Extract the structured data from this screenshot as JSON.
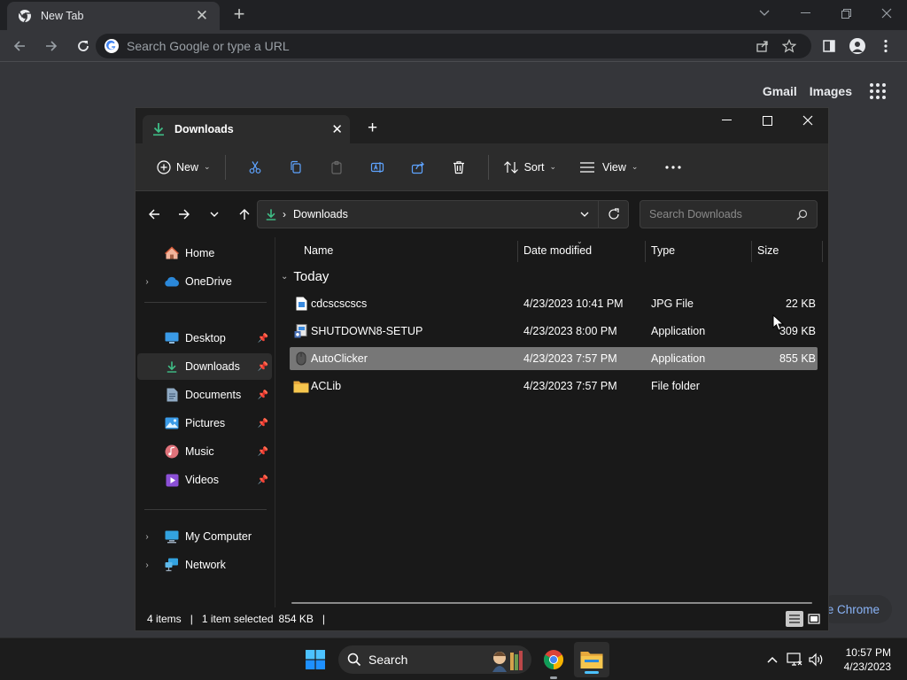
{
  "browser": {
    "tab_title": "New Tab",
    "omnibox_placeholder": "Search Google or type a URL",
    "ntp_links": {
      "gmail": "Gmail",
      "images": "Images"
    },
    "customize_label": "e Chrome"
  },
  "explorer": {
    "tab_title": "Downloads",
    "command_bar": {
      "new_label": "New",
      "sort_label": "Sort",
      "view_label": "View"
    },
    "address": {
      "crumb": "Downloads",
      "search_placeholder": "Search Downloads"
    },
    "nav": {
      "home": "Home",
      "onedrive": "OneDrive",
      "desktop": "Desktop",
      "downloads": "Downloads",
      "documents": "Documents",
      "pictures": "Pictures",
      "music": "Music",
      "videos": "Videos",
      "my_computer": "My Computer",
      "network": "Network"
    },
    "columns": {
      "name": "Name",
      "date": "Date modified",
      "type": "Type",
      "size": "Size"
    },
    "group": "Today",
    "files": [
      {
        "name": "cdcscscscs",
        "date": "4/23/2023 10:41 PM",
        "type": "JPG File",
        "size": "22 KB"
      },
      {
        "name": "SHUTDOWN8-SETUP",
        "date": "4/23/2023 8:00 PM",
        "type": "Application",
        "size": "309 KB"
      },
      {
        "name": "AutoClicker",
        "date": "4/23/2023 7:57 PM",
        "type": "Application",
        "size": "855 KB"
      },
      {
        "name": "ACLib",
        "date": "4/23/2023 7:57 PM",
        "type": "File folder",
        "size": ""
      }
    ],
    "status": {
      "items": "4 items",
      "selected": "1 item selected",
      "selected_size": "854 KB"
    }
  },
  "taskbar": {
    "search_label": "Search",
    "time": "10:57 PM",
    "date": "4/23/2023"
  }
}
